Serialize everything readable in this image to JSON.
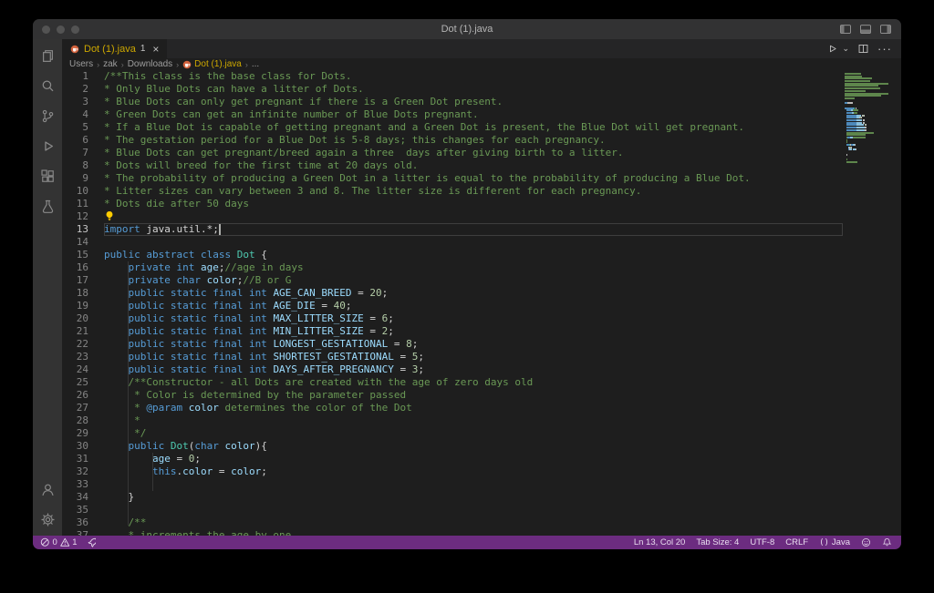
{
  "window": {
    "title": "Dot (1).java"
  },
  "tab": {
    "label": "Dot (1).java",
    "badge": "1",
    "close_label": "×"
  },
  "breadcrumb": {
    "items": [
      {
        "label": "Users"
      },
      {
        "label": "zak"
      },
      {
        "label": "Downloads"
      },
      {
        "label": "Dot (1).java",
        "icon": "java",
        "warn": true
      },
      {
        "label": "..."
      }
    ]
  },
  "status": {
    "errors": "0",
    "warnings": "1",
    "cursor": "Ln 13, Col 20",
    "tab_size": "Tab Size: 4",
    "encoding": "UTF-8",
    "eol": "CRLF",
    "language_icon": "()",
    "language": "Java"
  },
  "editor": {
    "current_line": 13,
    "palette": {
      "cm": "#6a9955",
      "kw": "#569cd6",
      "cl": "#4ec9b0",
      "vr": "#9cdcfe",
      "num": "#b5cea8",
      "pl": "#d4d4d4"
    },
    "lines": [
      {
        "n": 1,
        "t": [
          [
            "cm",
            "/**This class is the base class for Dots."
          ]
        ]
      },
      {
        "n": 2,
        "t": [
          [
            "cm",
            "* Only Blue Dots can have a litter of Dots."
          ]
        ]
      },
      {
        "n": 3,
        "t": [
          [
            "cm",
            "* Blue Dots can only get pregnant if there is a Green Dot present."
          ]
        ]
      },
      {
        "n": 4,
        "t": [
          [
            "cm",
            "* Green Dots can get an infinite number of Blue Dots pregnant."
          ]
        ]
      },
      {
        "n": 5,
        "t": [
          [
            "cm",
            "* If a Blue Dot is capable of getting pregnant and a Green Dot is present, the Blue Dot will get pregnant."
          ]
        ]
      },
      {
        "n": 6,
        "t": [
          [
            "cm",
            "* The gestation period for a Blue Dot is 5-8 days; this changes for each pregnancy."
          ]
        ]
      },
      {
        "n": 7,
        "t": [
          [
            "cm",
            "* Blue Dots can get pregnant/breed again a three  days after giving birth to a litter."
          ]
        ]
      },
      {
        "n": 8,
        "t": [
          [
            "cm",
            "* Dots will breed for the first time at 20 days old."
          ]
        ]
      },
      {
        "n": 9,
        "t": [
          [
            "cm",
            "* The probability of producing a Green Dot in a litter is equal to the probability of producing a Blue Dot."
          ]
        ]
      },
      {
        "n": 10,
        "t": [
          [
            "cm",
            "* Litter sizes can vary between 3 and 8. The litter size is different for each pregnancy."
          ]
        ]
      },
      {
        "n": 11,
        "t": [
          [
            "cm",
            "* Dots die after 50 days"
          ]
        ]
      },
      {
        "n": 12,
        "t": [],
        "lightbulb": true
      },
      {
        "n": 13,
        "t": [
          [
            "kw",
            "import"
          ],
          [
            "pl",
            " java.util.*;"
          ]
        ]
      },
      {
        "n": 14,
        "t": []
      },
      {
        "n": 15,
        "t": [
          [
            "kw",
            "public abstract class "
          ],
          [
            "cl",
            "Dot"
          ],
          [
            "pl",
            " {"
          ]
        ]
      },
      {
        "n": 16,
        "t": [
          [
            "kw",
            "    private int "
          ],
          [
            "vr",
            "age"
          ],
          [
            "pl",
            ";"
          ],
          [
            "cm",
            "//age in days"
          ]
        ]
      },
      {
        "n": 17,
        "t": [
          [
            "kw",
            "    private char "
          ],
          [
            "vr",
            "color"
          ],
          [
            "pl",
            ";"
          ],
          [
            "cm",
            "//B or G"
          ]
        ]
      },
      {
        "n": 18,
        "t": [
          [
            "kw",
            "    public static final int "
          ],
          [
            "vr",
            "AGE_CAN_BREED"
          ],
          [
            "pl",
            " = "
          ],
          [
            "num",
            "20"
          ],
          [
            "pl",
            ";"
          ]
        ]
      },
      {
        "n": 19,
        "t": [
          [
            "kw",
            "    public static final int "
          ],
          [
            "vr",
            "AGE_DIE"
          ],
          [
            "pl",
            " = "
          ],
          [
            "num",
            "40"
          ],
          [
            "pl",
            ";"
          ]
        ]
      },
      {
        "n": 20,
        "t": [
          [
            "kw",
            "    public static final int "
          ],
          [
            "vr",
            "MAX_LITTER_SIZE"
          ],
          [
            "pl",
            " = "
          ],
          [
            "num",
            "6"
          ],
          [
            "pl",
            ";"
          ]
        ]
      },
      {
        "n": 21,
        "t": [
          [
            "kw",
            "    public static final int "
          ],
          [
            "vr",
            "MIN_LITTER_SIZE"
          ],
          [
            "pl",
            " = "
          ],
          [
            "num",
            "2"
          ],
          [
            "pl",
            ";"
          ]
        ]
      },
      {
        "n": 22,
        "t": [
          [
            "kw",
            "    public static final int "
          ],
          [
            "vr",
            "LONGEST_GESTATIONAL"
          ],
          [
            "pl",
            " = "
          ],
          [
            "num",
            "8"
          ],
          [
            "pl",
            ";"
          ]
        ]
      },
      {
        "n": 23,
        "t": [
          [
            "kw",
            "    public static final int "
          ],
          [
            "vr",
            "SHORTEST_GESTATIONAL"
          ],
          [
            "pl",
            " = "
          ],
          [
            "num",
            "5"
          ],
          [
            "pl",
            ";"
          ]
        ]
      },
      {
        "n": 24,
        "t": [
          [
            "kw",
            "    public static final int "
          ],
          [
            "vr",
            "DAYS_AFTER_PREGNANCY"
          ],
          [
            "pl",
            " = "
          ],
          [
            "num",
            "3"
          ],
          [
            "pl",
            ";"
          ]
        ]
      },
      {
        "n": 25,
        "t": [
          [
            "cm",
            "    /**Constructor - all Dots are created with the age of zero days old"
          ]
        ]
      },
      {
        "n": 26,
        "t": [
          [
            "cm",
            "     * Color is determined by the parameter passed"
          ]
        ]
      },
      {
        "n": 27,
        "t": [
          [
            "cm",
            "     * "
          ],
          [
            "kw",
            "@param"
          ],
          [
            "vr",
            " color"
          ],
          [
            "cm",
            " determines the color of the Dot"
          ]
        ]
      },
      {
        "n": 28,
        "t": [
          [
            "cm",
            "     *"
          ]
        ]
      },
      {
        "n": 29,
        "t": [
          [
            "cm",
            "     */"
          ]
        ]
      },
      {
        "n": 30,
        "t": [
          [
            "kw",
            "    public "
          ],
          [
            "cl",
            "Dot"
          ],
          [
            "pl",
            "("
          ],
          [
            "kw",
            "char "
          ],
          [
            "vr",
            "color"
          ],
          [
            "pl",
            "){"
          ]
        ]
      },
      {
        "n": 31,
        "t": [
          [
            "pl",
            "        "
          ],
          [
            "vr",
            "age"
          ],
          [
            "pl",
            " = "
          ],
          [
            "num",
            "0"
          ],
          [
            "pl",
            ";"
          ]
        ]
      },
      {
        "n": 32,
        "t": [
          [
            "pl",
            "        "
          ],
          [
            "kw",
            "this"
          ],
          [
            "pl",
            "."
          ],
          [
            "vr",
            "color"
          ],
          [
            "pl",
            " = "
          ],
          [
            "vr",
            "color"
          ],
          [
            "pl",
            ";"
          ]
        ]
      },
      {
        "n": 33,
        "t": []
      },
      {
        "n": 34,
        "t": [
          [
            "pl",
            "    }"
          ]
        ]
      },
      {
        "n": 35,
        "t": []
      },
      {
        "n": 36,
        "t": [
          [
            "cm",
            "    /**"
          ]
        ]
      },
      {
        "n": 37,
        "t": [
          [
            "cm",
            "    * increments the age by one"
          ]
        ]
      }
    ]
  }
}
